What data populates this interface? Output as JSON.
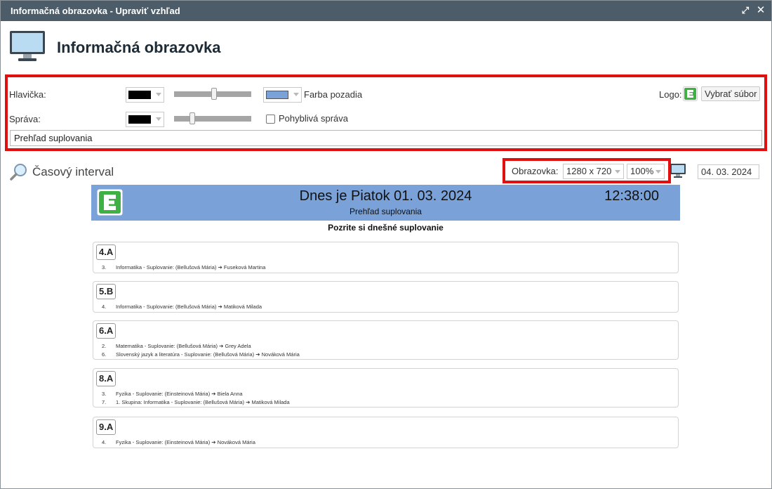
{
  "window": {
    "title": "Informačná obrazovka - Upraviť vzhľad",
    "maximize_icon": "expand-icon",
    "close_icon": "close-icon"
  },
  "header": {
    "title": "Informačná obrazovka",
    "icon": "monitor-icon"
  },
  "settings": {
    "header_label": "Hlavička:",
    "header_color": "#000000",
    "header_slider_percent": 52,
    "background_color": "#7aa2d8",
    "background_label": "Farba pozadia",
    "message_label": "Správa:",
    "message_color": "#000000",
    "message_slider_percent": 22,
    "moving_message_label": "Pohyblivá správa",
    "moving_message_checked": false,
    "message_text": "Prehľad suplovania",
    "logo_label": "Logo:",
    "choose_file_label": "Vybrať súbor"
  },
  "interval": {
    "title": "Časový interval",
    "icon": "search-icon"
  },
  "screen": {
    "label": "Obrazovka:",
    "resolution": "1280 x 720",
    "zoom": "100%",
    "date": "04. 03. 2024"
  },
  "preview": {
    "date_text": "Dnes je Piatok 01. 03. 2024",
    "time": "12:38:00",
    "message": "Prehľad suplovania",
    "subtitle": "Pozrite si dnešné suplovanie",
    "classes": [
      {
        "name": "4.A",
        "rows": [
          {
            "num": "3.",
            "text": "Informatika - Suplovanie: (Bellušová Mária) ➔ Fuseková Martina"
          }
        ]
      },
      {
        "name": "5.B",
        "rows": [
          {
            "num": "4.",
            "text": "Informatika - Suplovanie: (Bellušová Mária) ➔ Matiková Milada"
          }
        ]
      },
      {
        "name": "6.A",
        "rows": [
          {
            "num": "2.",
            "text": "Matematika - Suplovanie: (Bellušová Mária) ➔ Grey Adela"
          },
          {
            "num": "6.",
            "text": "Slovenský jazyk a literatúra - Suplovanie: (Bellušová Mária) ➔ Nováková Mária"
          }
        ]
      },
      {
        "name": "8.A",
        "rows": [
          {
            "num": "3.",
            "text": "Fyzika - Suplovanie: (Einsteinová Mária) ➔ Biela Anna"
          },
          {
            "num": "7.",
            "text": "1. Skupina: Informatika - Suplovanie: (Bellušová Mária) ➔ Matiková Milada"
          }
        ]
      },
      {
        "name": "9.A",
        "rows": [
          {
            "num": "4.",
            "text": "Fyzika - Suplovanie: (Einsteinová Mária) ➔ Nováková Mária"
          }
        ]
      }
    ]
  }
}
